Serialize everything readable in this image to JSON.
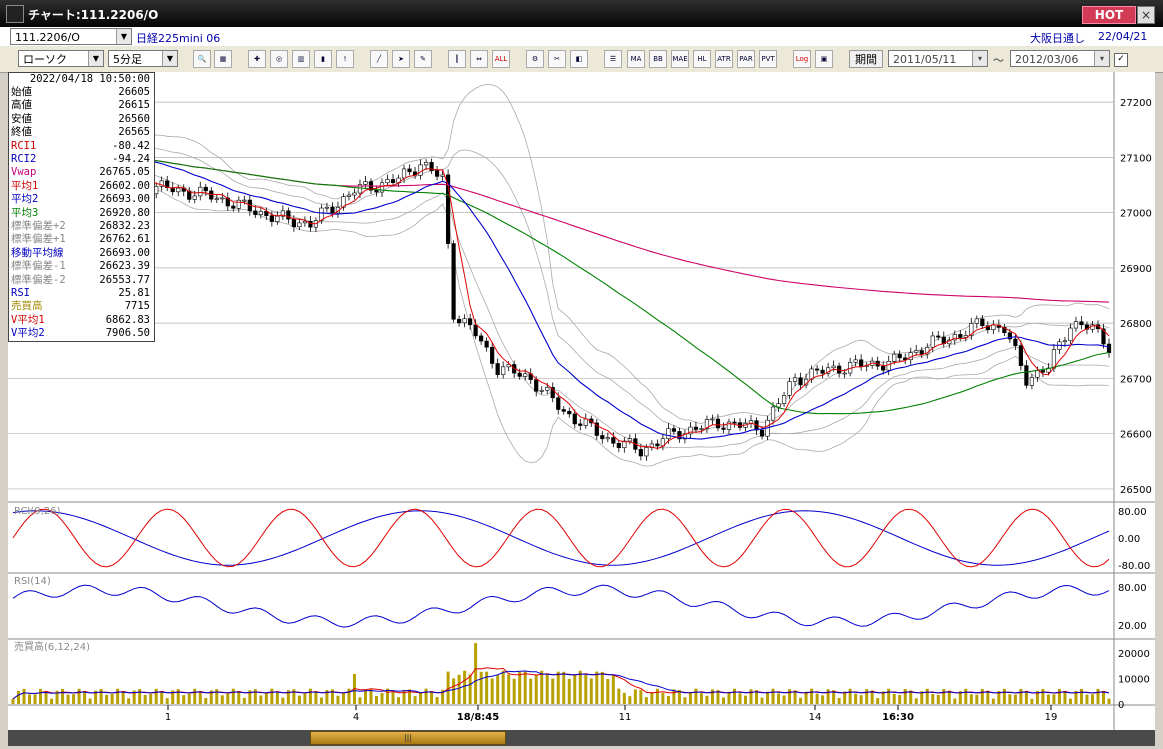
{
  "window": {
    "title": "チャート:111.2206/O",
    "hot_label": "HOT",
    "close_label": "×"
  },
  "symbol_bar": {
    "symbol_value": "111.2206/O",
    "instrument_name": "日経225mini 06",
    "session_label": "大阪日通し",
    "date": "22/04/21"
  },
  "toolbar": {
    "chart_type": "ローソク",
    "interval": "5分足",
    "period_label": "期間",
    "date_from": "2011/05/11",
    "date_to": "2012/03/06",
    "tilde": "〜",
    "indicator_buttons": [
      "MA",
      "BB",
      "MAE",
      "HL",
      "ATR",
      "PAR",
      "PVT"
    ],
    "log_label": "Log"
  },
  "info": {
    "datetime": "2022/04/18  10:50:00",
    "rows": [
      {
        "k": "始値",
        "v": "26605",
        "c": "#000000"
      },
      {
        "k": "高値",
        "v": "26615",
        "c": "#000000"
      },
      {
        "k": "安値",
        "v": "26560",
        "c": "#000000"
      },
      {
        "k": "終値",
        "v": "26565",
        "c": "#000000"
      },
      {
        "k": "RCI1",
        "v": "-80.42",
        "c": "#d00000"
      },
      {
        "k": "RCI2",
        "v": "-94.24",
        "c": "#0000c0"
      },
      {
        "k": "Vwap",
        "v": "26765.05",
        "c": "#c0007a"
      },
      {
        "k": "平均1",
        "v": "26602.00",
        "c": "#d00000"
      },
      {
        "k": "平均2",
        "v": "26693.00",
        "c": "#0000c0"
      },
      {
        "k": "平均3",
        "v": "26920.80",
        "c": "#008000"
      },
      {
        "k": "標準偏差+2",
        "v": "26832.23",
        "c": "#888888"
      },
      {
        "k": "標準偏差+1",
        "v": "26762.61",
        "c": "#888888"
      },
      {
        "k": "移動平均線",
        "v": "26693.00",
        "c": "#0000c0"
      },
      {
        "k": "標準偏差-1",
        "v": "26623.39",
        "c": "#888888"
      },
      {
        "k": "標準偏差-2",
        "v": "26553.77",
        "c": "#888888"
      },
      {
        "k": "RSI",
        "v": "25.81",
        "c": "#0000c0"
      },
      {
        "k": "売買高",
        "v": "7715",
        "c": "#a08a00"
      },
      {
        "k": "V平均1",
        "v": "6862.83",
        "c": "#d00000"
      },
      {
        "k": "V平均2",
        "v": "7906.50",
        "c": "#0000c0"
      }
    ]
  },
  "chart_data": {
    "type": "line",
    "price_axis": {
      "ylim": [
        26480,
        27240
      ],
      "ticks": [
        27200,
        27100,
        27000,
        26900,
        26800,
        26700,
        26600,
        26500
      ]
    },
    "x_ticks": [
      "1",
      "4",
      "18/8:45",
      "11",
      "14",
      "16:30",
      "19"
    ],
    "panels": [
      {
        "label": "RCI(9,26)",
        "ticks": [
          "80.00",
          "0.00",
          "-80.00"
        ]
      },
      {
        "label": "RSI(14)",
        "ticks": [
          "80.00",
          "20.00"
        ]
      },
      {
        "label": "売買高(6,12,24)",
        "ticks": [
          "20000",
          "10000",
          "0"
        ]
      }
    ],
    "colors": {
      "ma1": "#e00000",
      "ma2": "#0000cc",
      "ma3": "#008000",
      "vwap": "#d0006a",
      "band": "#aaaaaa",
      "candle": "#000000",
      "volume": "#b8a000"
    }
  }
}
